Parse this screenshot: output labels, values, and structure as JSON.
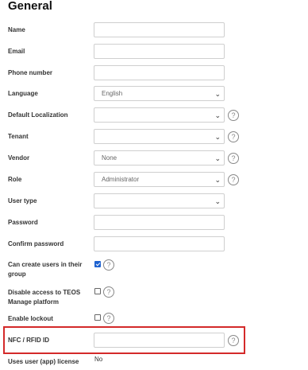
{
  "section_title": "General",
  "fields": {
    "name": {
      "label": "Name",
      "value": ""
    },
    "email": {
      "label": "Email",
      "value": ""
    },
    "phone": {
      "label": "Phone number",
      "value": ""
    },
    "language": {
      "label": "Language",
      "value": "English"
    },
    "default_localization": {
      "label": "Default Localization",
      "value": ""
    },
    "tenant": {
      "label": "Tenant",
      "value": ""
    },
    "vendor": {
      "label": "Vendor",
      "value": "None"
    },
    "role": {
      "label": "Role",
      "value": "Administrator"
    },
    "user_type": {
      "label": "User type",
      "value": ""
    },
    "password": {
      "label": "Password",
      "value": ""
    },
    "confirm_password": {
      "label": "Confirm password",
      "value": ""
    },
    "can_create_users": {
      "label": "Can create users in their group",
      "checked": true
    },
    "disable_access": {
      "label": "Disable access to TEOS Manage platform",
      "checked": false
    },
    "enable_lockout": {
      "label": "Enable lockout",
      "checked": false
    },
    "nfc_rfid": {
      "label": "NFC / RFID ID",
      "value": ""
    },
    "uses_user_license": {
      "label": "Uses user (app) license",
      "value": "No"
    }
  },
  "help_glyph": "?",
  "chevron_glyph": "⌄",
  "colors": {
    "highlight": "#d42a2a",
    "checkbox_checked": "#1e62d0"
  }
}
